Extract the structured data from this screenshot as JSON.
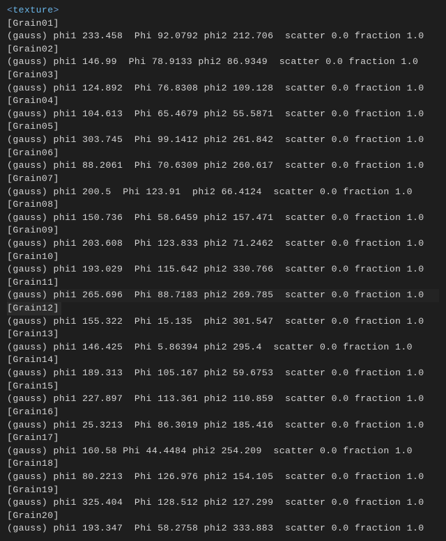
{
  "tag_open": "<",
  "tag_name": "texture",
  "tag_close": ">",
  "grains": [
    {
      "header": "[Grain01]",
      "line": "(gauss) phi1 233.458  Phi 92.0792 phi2 212.706  scatter 0.0 fraction 1.0"
    },
    {
      "header": "[Grain02]",
      "line": "(gauss) phi1 146.99  Phi 78.9133 phi2 86.9349  scatter 0.0 fraction 1.0"
    },
    {
      "header": "[Grain03]",
      "line": "(gauss) phi1 124.892  Phi 76.8308 phi2 109.128  scatter 0.0 fraction 1.0"
    },
    {
      "header": "[Grain04]",
      "line": "(gauss) phi1 104.613  Phi 65.4679 phi2 55.5871  scatter 0.0 fraction 1.0"
    },
    {
      "header": "[Grain05]",
      "line": "(gauss) phi1 303.745  Phi 99.1412 phi2 261.842  scatter 0.0 fraction 1.0"
    },
    {
      "header": "[Grain06]",
      "line": "(gauss) phi1 88.2061  Phi 70.6309 phi2 260.617  scatter 0.0 fraction 1.0"
    },
    {
      "header": "[Grain07]",
      "line": "(gauss) phi1 200.5  Phi 123.91  phi2 66.4124  scatter 0.0 fraction 1.0"
    },
    {
      "header": "[Grain08]",
      "line": "(gauss) phi1 150.736  Phi 58.6459 phi2 157.471  scatter 0.0 fraction 1.0"
    },
    {
      "header": "[Grain09]",
      "line": "(gauss) phi1 203.608  Phi 123.833 phi2 71.2462  scatter 0.0 fraction 1.0"
    },
    {
      "header": "[Grain10]",
      "line": "(gauss) phi1 193.029  Phi 115.642 phi2 330.766  scatter 0.0 fraction 1.0"
    },
    {
      "header": "[Grain11]",
      "line": "(gauss) phi1 265.696  Phi 88.7183 phi2 269.785  scatter 0.0 fraction 1.0"
    },
    {
      "header": "[Grain12]",
      "line": "(gauss) phi1 155.322  Phi 15.135  phi2 301.547  scatter 0.0 fraction 1.0"
    },
    {
      "header": "[Grain13]",
      "line": "(gauss) phi1 146.425  Phi 5.86394 phi2 295.4  scatter 0.0 fraction 1.0"
    },
    {
      "header": "[Grain14]",
      "line": "(gauss) phi1 189.313  Phi 105.167 phi2 59.6753  scatter 0.0 fraction 1.0"
    },
    {
      "header": "[Grain15]",
      "line": "(gauss) phi1 227.897  Phi 113.361 phi2 110.859  scatter 0.0 fraction 1.0"
    },
    {
      "header": "[Grain16]",
      "line": "(gauss) phi1 25.3213  Phi 86.3019 phi2 185.416  scatter 0.0 fraction 1.0"
    },
    {
      "header": "[Grain17]",
      "line": "(gauss) phi1 160.58 Phi 44.4484 phi2 254.209  scatter 0.0 fraction 1.0"
    },
    {
      "header": "[Grain18]",
      "line": "(gauss) phi1 80.2213  Phi 126.976 phi2 154.105  scatter 0.0 fraction 1.0"
    },
    {
      "header": "[Grain19]",
      "line": "(gauss) phi1 325.404  Phi 128.512 phi2 127.299  scatter 0.0 fraction 1.0"
    },
    {
      "header": "[Grain20]",
      "line": "(gauss) phi1 193.347  Phi 58.2758 phi2 333.883  scatter 0.0 fraction 1.0"
    }
  ],
  "highlighted_index": 11,
  "soft_highlight_index": 10
}
